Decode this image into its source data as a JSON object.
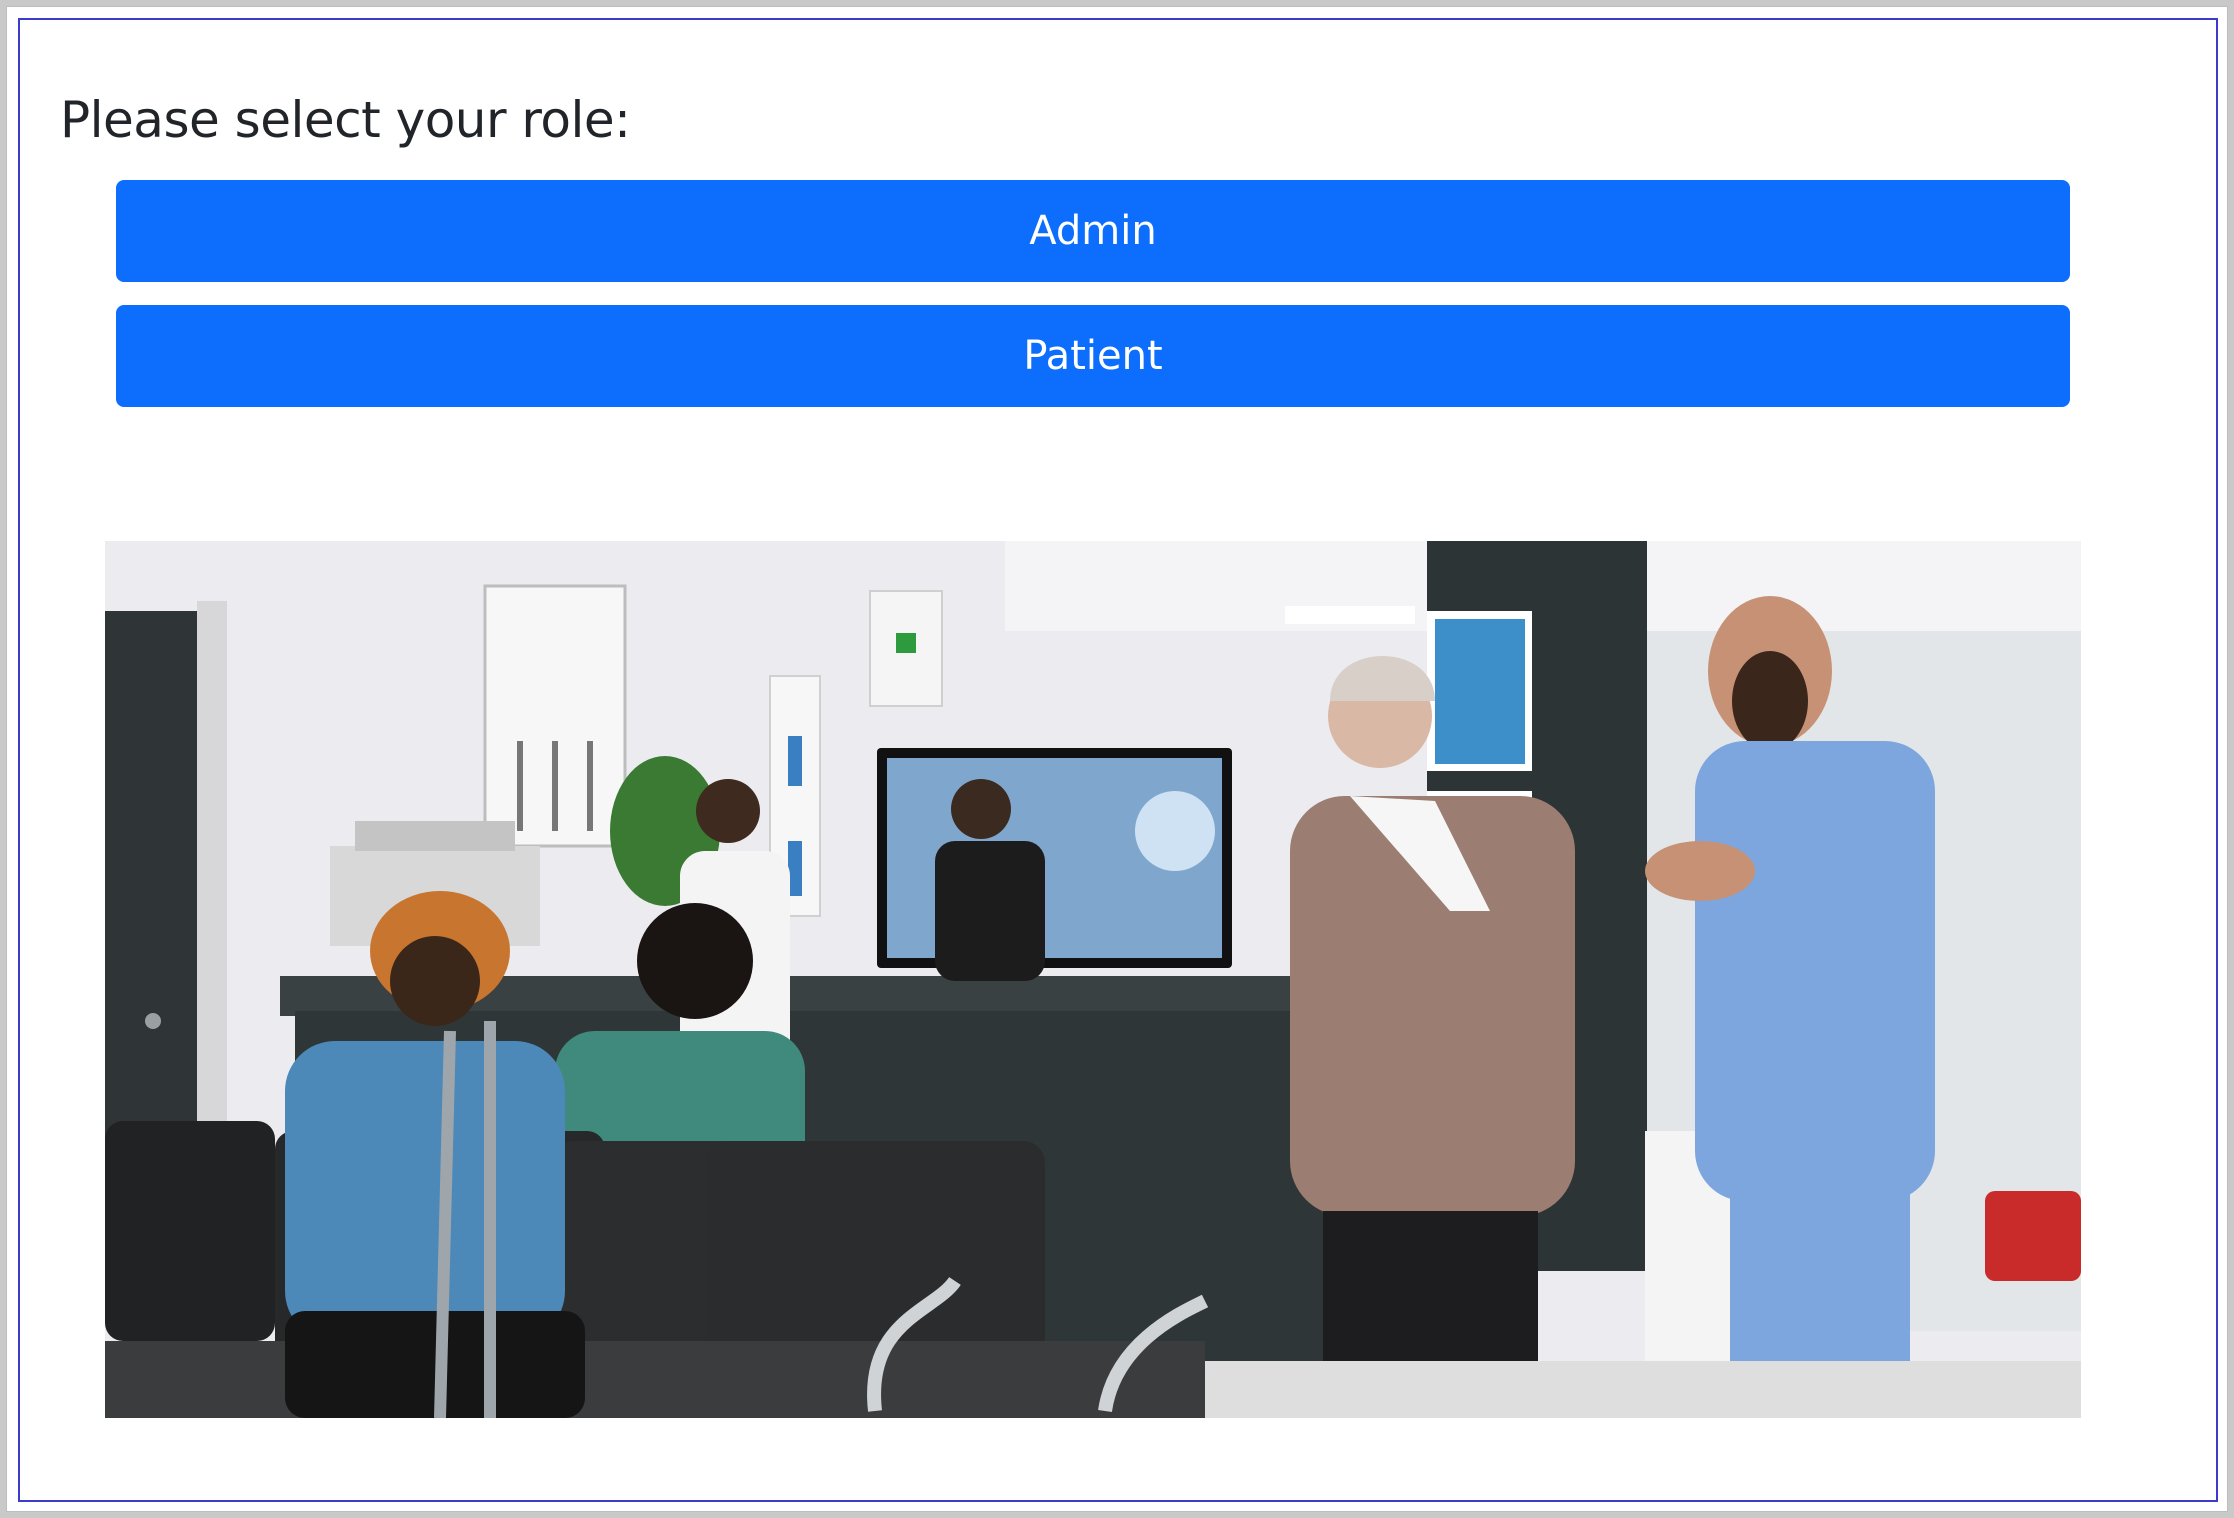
{
  "page": {
    "heading": "Please select your role:"
  },
  "roles": [
    {
      "label": "Admin"
    },
    {
      "label": "Patient"
    }
  ],
  "theme": {
    "button_color": "#0d6efd",
    "frame_border": "#3c3ccc"
  }
}
